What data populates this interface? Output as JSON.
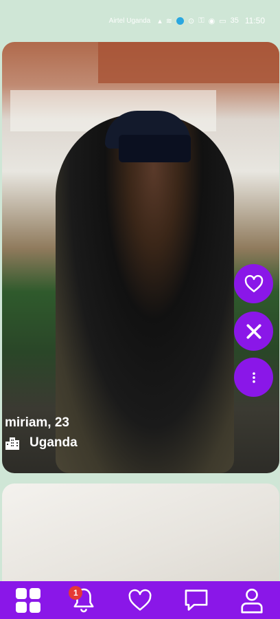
{
  "status_bar": {
    "carrier": "Airtel Uganda",
    "battery": "35",
    "time": "11:50"
  },
  "profile_card": {
    "name": "miriam, 23",
    "location": "Uganda"
  },
  "action_buttons": {
    "like_icon": "heart-icon",
    "dislike_icon": "close-icon",
    "more_icon": "more-vertical-icon"
  },
  "bottom_nav": {
    "items": [
      {
        "icon": "grid-icon"
      },
      {
        "icon": "bell-icon",
        "badge": "1"
      },
      {
        "icon": "heart-icon"
      },
      {
        "icon": "chat-icon"
      },
      {
        "icon": "user-icon"
      }
    ]
  },
  "colors": {
    "accent": "#8a17e8",
    "background": "#cfe6d6",
    "badge": "#e53935"
  }
}
